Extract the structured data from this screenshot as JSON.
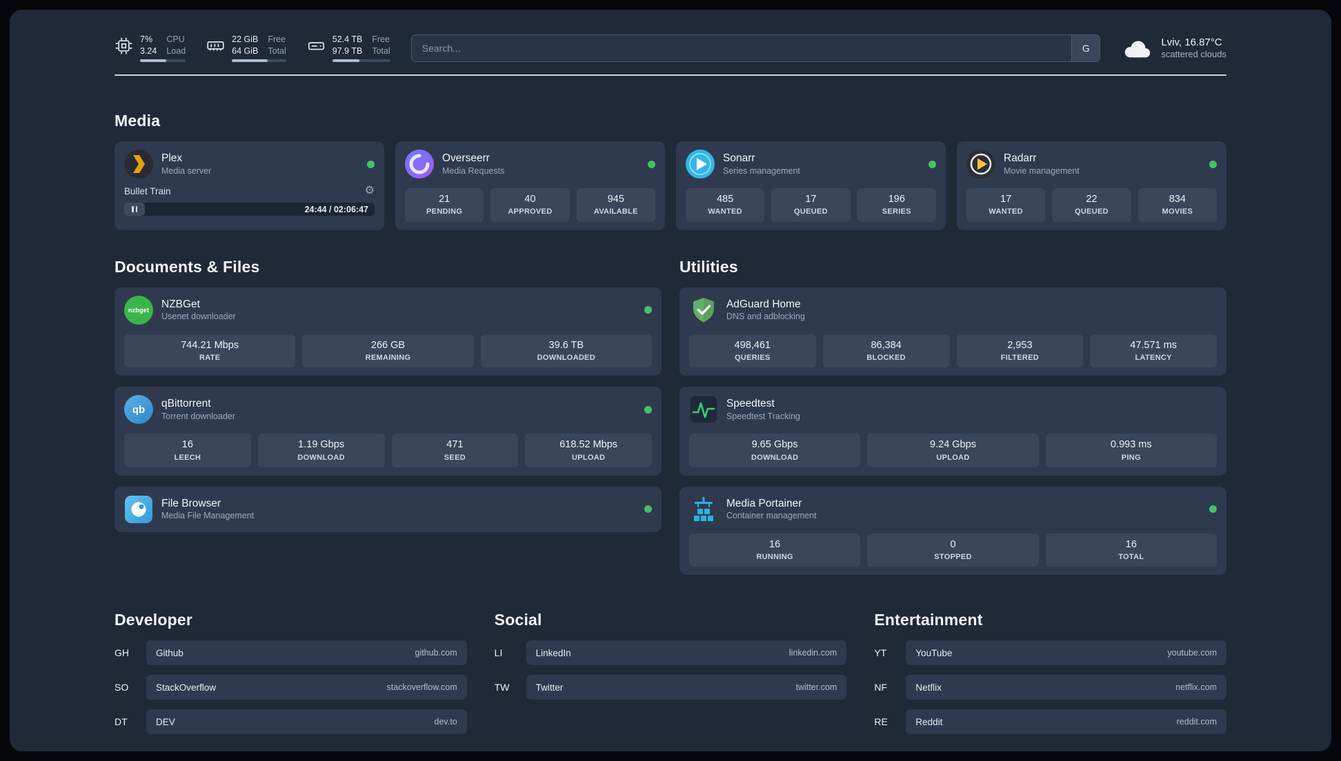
{
  "theme": {
    "page_bg": "#202938",
    "card_bg": "#2f3a4e",
    "tile_bg": "#3a465a",
    "status_green": "#42c268",
    "plex_accent": "#e5a00d",
    "divider": "#ccd3e0"
  },
  "icons": {
    "gear": "⚙"
  },
  "topbar": {
    "cpu": {
      "value_top": "7%",
      "value_bottom": "3.24",
      "label_top": "CPU",
      "label_bottom": "Load",
      "bar_style": "width:58%"
    },
    "ram": {
      "value_top": "22 GiB",
      "value_bottom": "64 GiB",
      "label_top": "Free",
      "label_bottom": "Total",
      "bar_style": "width:66%"
    },
    "disk": {
      "value_top": "52.4 TB",
      "value_bottom": "97.9 TB",
      "label_top": "Free",
      "label_bottom": "Total",
      "bar_style": "width:47%"
    },
    "search": {
      "placeholder": "Search...",
      "button_label": "G"
    },
    "weather": {
      "location": "Lviv, 16.87°C",
      "condition": "scattered clouds"
    }
  },
  "media": {
    "title": "Media",
    "plex": {
      "name": "Plex",
      "subtitle": "Media server",
      "now_playing": "Bullet Train",
      "time": "24:44 / 02:06:47"
    },
    "overseerr": {
      "name": "Overseerr",
      "subtitle": "Media Requests",
      "stats": [
        {
          "value": "21",
          "label": "PENDING"
        },
        {
          "value": "40",
          "label": "APPROVED"
        },
        {
          "value": "945",
          "label": "AVAILABLE"
        }
      ]
    },
    "sonarr": {
      "name": "Sonarr",
      "subtitle": "Series management",
      "stats": [
        {
          "value": "485",
          "label": "WANTED"
        },
        {
          "value": "17",
          "label": "QUEUED"
        },
        {
          "value": "196",
          "label": "SERIES"
        }
      ]
    },
    "radarr": {
      "name": "Radarr",
      "subtitle": "Movie management",
      "stats": [
        {
          "value": "17",
          "label": "WANTED"
        },
        {
          "value": "22",
          "label": "QUEUED"
        },
        {
          "value": "834",
          "label": "MOVIES"
        }
      ]
    }
  },
  "documents": {
    "title": "Documents & Files",
    "nzbget": {
      "name": "NZBGet",
      "subtitle": "Usenet downloader",
      "icon_text": "nzbget",
      "stats": [
        {
          "value": "744.21 Mbps",
          "label": "RATE"
        },
        {
          "value": "266 GB",
          "label": "REMAINING"
        },
        {
          "value": "39.6 TB",
          "label": "DOWNLOADED"
        }
      ]
    },
    "qbittorrent": {
      "name": "qBittorrent",
      "subtitle": "Torrent downloader",
      "icon_text": "qb",
      "stats": [
        {
          "value": "16",
          "label": "LEECH"
        },
        {
          "value": "1.19 Gbps",
          "label": "DOWNLOAD"
        },
        {
          "value": "471",
          "label": "SEED"
        },
        {
          "value": "618.52 Mbps",
          "label": "UPLOAD"
        }
      ]
    },
    "filebrowser": {
      "name": "File Browser",
      "subtitle": "Media File Management"
    }
  },
  "utilities": {
    "title": "Utilities",
    "adguard": {
      "name": "AdGuard Home",
      "subtitle": "DNS and adblocking",
      "stats": [
        {
          "value": "498,461",
          "label": "QUERIES"
        },
        {
          "value": "86,384",
          "label": "BLOCKED"
        },
        {
          "value": "2,953",
          "label": "FILTERED"
        },
        {
          "value": "47.571 ms",
          "label": "LATENCY"
        }
      ]
    },
    "speedtest": {
      "name": "Speedtest",
      "subtitle": "Speedtest Tracking",
      "stats": [
        {
          "value": "9.65 Gbps",
          "label": "DOWNLOAD"
        },
        {
          "value": "9.24 Gbps",
          "label": "UPLOAD"
        },
        {
          "value": "0.993 ms",
          "label": "PING"
        }
      ]
    },
    "portainer": {
      "name": "Media Portainer",
      "subtitle": "Container management",
      "stats": [
        {
          "value": "16",
          "label": "RUNNING"
        },
        {
          "value": "0",
          "label": "STOPPED"
        },
        {
          "value": "16",
          "label": "TOTAL"
        }
      ]
    }
  },
  "bookmarks": {
    "developer": {
      "title": "Developer",
      "items": [
        {
          "abbr": "GH",
          "name": "Github",
          "url": "github.com"
        },
        {
          "abbr": "SO",
          "name": "StackOverflow",
          "url": "stackoverflow.com"
        },
        {
          "abbr": "DT",
          "name": "DEV",
          "url": "dev.to"
        }
      ]
    },
    "social": {
      "title": "Social",
      "items": [
        {
          "abbr": "LI",
          "name": "LinkedIn",
          "url": "linkedin.com"
        },
        {
          "abbr": "TW",
          "name": "Twitter",
          "url": "twitter.com"
        }
      ]
    },
    "entertainment": {
      "title": "Entertainment",
      "items": [
        {
          "abbr": "YT",
          "name": "YouTube",
          "url": "youtube.com"
        },
        {
          "abbr": "NF",
          "name": "Netflix",
          "url": "netflix.com"
        },
        {
          "abbr": "RE",
          "name": "Reddit",
          "url": "reddit.com"
        }
      ]
    }
  }
}
